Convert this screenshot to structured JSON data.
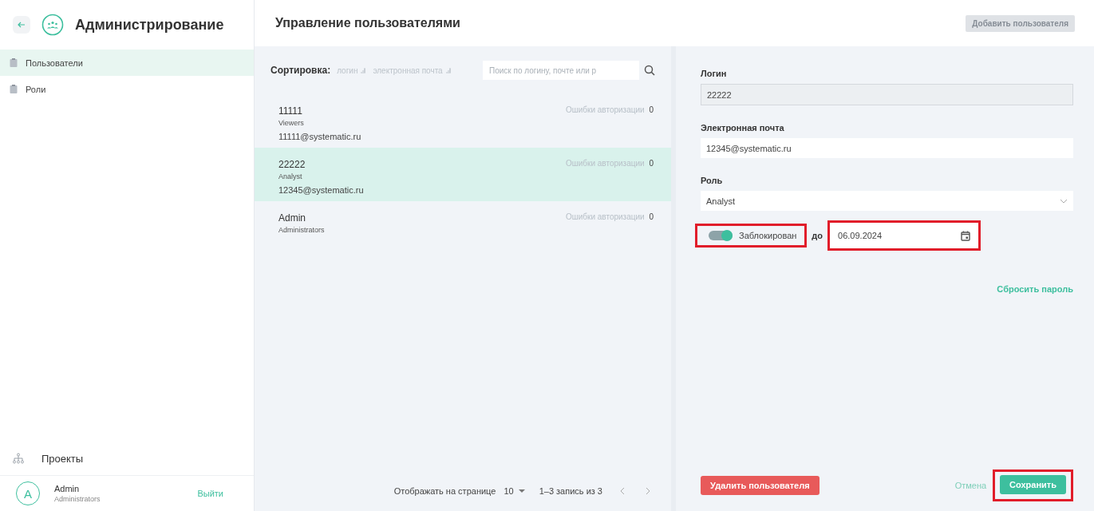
{
  "sidebar": {
    "title": "Администрирование",
    "items": [
      {
        "label": "Пользователи",
        "selected": true
      },
      {
        "label": "Роли",
        "selected": false
      }
    ],
    "projects": "Проекты",
    "user": {
      "initial": "A",
      "name": "Admin",
      "role": "Administrators"
    },
    "logout": "Выйти"
  },
  "page": {
    "title": "Управление пользователями",
    "add_button": {
      "label": "Добавить пользователя",
      "disabled": true
    }
  },
  "list": {
    "sort_label": "Сортировка:",
    "sort_options": [
      "логин",
      "электронная почта"
    ],
    "search_placeholder": "Поиск по логину, почте или р",
    "users": [
      {
        "login": "11111",
        "role": "Viewers",
        "email": "11111@systematic.ru",
        "errors_label": "Ошибки авторизации",
        "errors": "0",
        "selected": false
      },
      {
        "login": "22222",
        "role": "Analyst",
        "email": "12345@systematic.ru",
        "errors_label": "Ошибки авторизации",
        "errors": "0",
        "selected": true
      },
      {
        "login": "Admin",
        "role": "Administrators",
        "errors_label": "Ошибки авторизации",
        "errors": "0",
        "selected": false
      }
    ],
    "pagination": {
      "per_page_label": "Отображать на странице",
      "per_page": "10",
      "range": "1–3 запись из 3"
    }
  },
  "form": {
    "login_label": "Логин",
    "login": "22222",
    "email_label": "Электронная почта",
    "email": "12345@systematic.ru",
    "role_label": "Роль",
    "role": "Analyst",
    "blocked": {
      "label": "Заблокирован",
      "on": true,
      "highlighted": true
    },
    "until_label": "до",
    "date": {
      "value": "06.09.2024",
      "highlighted": true
    },
    "reset_link": "Сбросить пароль",
    "delete_button": "Удалить пользователя",
    "cancel_button": "Отмена",
    "save_button": {
      "label": "Сохранить",
      "highlighted": true
    }
  }
}
